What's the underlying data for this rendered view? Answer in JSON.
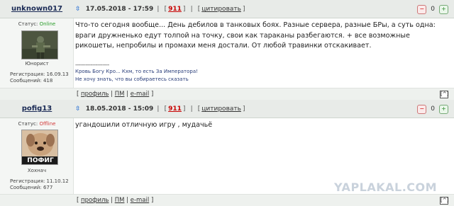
{
  "posts": [
    {
      "author": "unknown017",
      "datetime": "17.05.2018 - 17:59",
      "number": "911",
      "quote_label": "цитировать",
      "separator": "|",
      "status_label": "Статус:",
      "status_value": "Online",
      "user_title": "Юнорист",
      "reg_label": "Регистрация:",
      "reg_date": "16.09.13",
      "msgs_label": "Сообщений:",
      "msgs_count": "418",
      "vote_count": "0",
      "text": "Что-то сегодня вообще... День дебилов в танковых боях. Разные сервера, разные БРы, а суть одна: враги дружненько едут толпой на точку, свои как тараканы разбегаются. + все возможные рикошеты, непробилы и промахи меня достали. От любой травинки отскакивает.",
      "signature_divider": "--------------------",
      "signature_line1": "Кровь Богу Кро... Кхм, то есть За Императора!",
      "signature_line2": "Не хочу знать, что вы собираетесь сказать"
    },
    {
      "author": "pofig13",
      "datetime": "18.05.2018 - 15:09",
      "number": "911",
      "quote_label": "цитировать",
      "separator": "|",
      "status_label": "Статус:",
      "status_value": "Offline",
      "avatar_caption": "ПОФИГ",
      "user_title": "Хохнач",
      "reg_label": "Регистрация:",
      "reg_date": "11.10.12",
      "msgs_label": "Сообщений:",
      "msgs_count": "677",
      "vote_count": "0",
      "text": "угандошили отличную игру , мудачьё"
    }
  ],
  "footer": {
    "profile": "профиль",
    "pm": "ПМ",
    "email": "e-mail",
    "to_top": "[^]",
    "open_bracket": "[",
    "close_bracket": "]",
    "sep": "|"
  },
  "icons": {
    "post_link": "pin-icon",
    "vote_down": "minus-vote-icon",
    "vote_up": "plus-vote-icon"
  },
  "colors": {
    "header_bg": "#e8ebe8",
    "user_col_bg": "#f4f6f4",
    "online": "#2a9d2a",
    "offline": "#d23a3a",
    "post_number": "#c80000",
    "author": "#1a2a55",
    "signature": "#2a3e7a"
  },
  "watermark": "YAPLAKAL.COM"
}
